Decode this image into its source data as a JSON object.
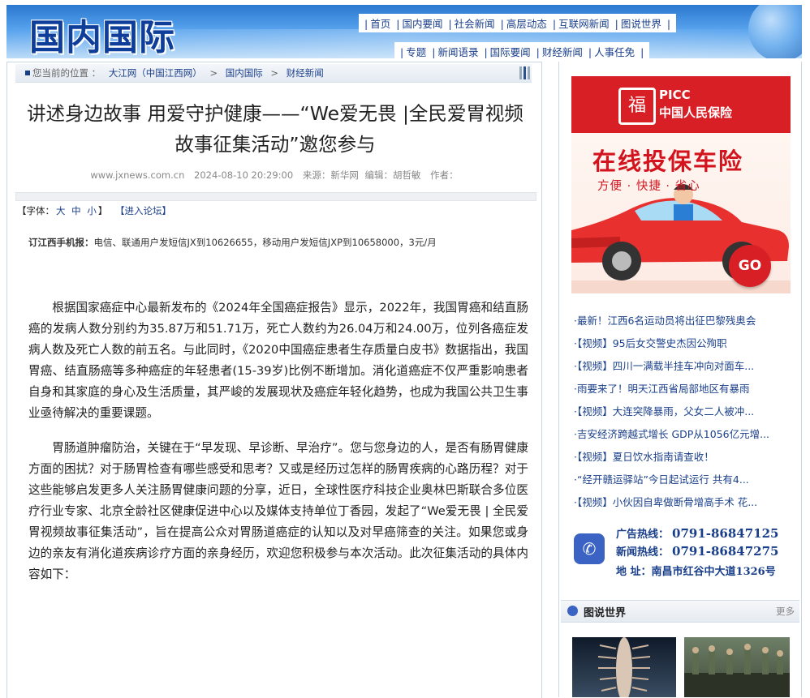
{
  "header": {
    "logo_text": "国内国际",
    "nav_row1": [
      "首页",
      "国内要闻",
      "社会新闻",
      "高层动态",
      "互联网新闻",
      "图说世界"
    ],
    "nav_row2": [
      "专题",
      "新闻语录",
      "国际要闻",
      "财经新闻",
      "人事任免"
    ]
  },
  "breadcrumb": {
    "prefix": "您当前的位置 ：",
    "items": [
      "大江网（中国江西网）",
      "国内国际",
      "财经新闻"
    ],
    "separator": ">"
  },
  "article": {
    "title": "讲述身边故事 用爱守护健康——“We爱无畏 |全民爱胃视频故事征集活动”邀您参与",
    "source_site": "www.jxnews.com.cn",
    "datetime": "2024-08-10 20:29:00",
    "source": "来源：新华网",
    "editor": "编辑：胡哲敏",
    "author": "作者：",
    "font_label": "【字体：",
    "font_sizes": [
      "大",
      "中",
      "小"
    ],
    "font_close": "】",
    "forum_link": "【进入论坛】",
    "subscribe_bold": "订江西手机报：",
    "subscribe_text": "电信、联通用户发短信JX到10626655，移动用户发短信JXP到10658000，3元/月",
    "paragraphs": [
      "根据国家癌症中心最新发布的《2024年全国癌症报告》显示，2022年，我国胃癌和结直肠癌的发病人数分别约为35.87万和51.71万，死亡人数约为26.04万和24.00万，位列各癌症发病人数及死亡人数的前五名。与此同时，《2020中国癌症患者生存质量白皮书》数据指出，我国胃癌、结直肠癌等多种癌症的年轻患者(15-39岁)比例不断增加。消化道癌症不仅严重影响患者自身和其家庭的身心及生活质量，其严峻的发展现状及癌症年轻化趋势，也成为我国公共卫生事业亟待解决的重要课题。",
      "胃肠道肿瘤防治，关键在于“早发现、早诊断、早治疗”。您与您身边的人，是否有肠胃健康方面的困扰？对于肠胃检查有哪些感受和思考？又或是经历过怎样的肠胃疾病的心路历程？对于这些能够启发更多人关注肠胃健康问题的分享，近日，全球性医疗科技企业奥林巴斯联合多位医疗行业专家、北京全龄社区健康促进中心以及媒体支持单位丁香园，发起了“We爱无畏 | 全民爱胃视频故事征集活动”，旨在提高公众对胃肠道癌症的认知以及对早癌筛查的关注。如果您或身边的亲友有消化道疾病诊疗方面的亲身经历，欢迎您积极参与本次活动。此次征集活动的具体内容如下："
    ]
  },
  "ad_picc": {
    "brand": "PICC",
    "brand_cn": "中国人民保险",
    "headline": "在线投保车险",
    "slogan": "方便 · 快捷 · 省心",
    "button": "GO",
    "colors": {
      "red": "#d81f26"
    }
  },
  "side_news": [
    "·最新！江西6名运动员将出征巴黎残奥会",
    "·【视频】95后女交警史杰因公殉职",
    "·【视频】四川一满载半挂车冲向对面车...",
    "·雨要来了！明天江西省局部地区有暴雨",
    "·【视频】大连突降暴雨，父女二人被冲...",
    "·吉安经济跨越式增长 GDP从1056亿元增...",
    "·【视频】夏日饮水指南请查收！",
    "·“经开赣运驿站”今日起试运行 共有4...",
    "·【视频】小伙因自卑做断骨增高手术 花..."
  ],
  "hotline": {
    "ad_label": "广告热线：",
    "ad_phone": "0791-86847125",
    "news_label": "新闻热线：",
    "news_phone": "0791-86847275",
    "addr_label": "地  址：",
    "addr": "南昌市红谷中大道1326号"
  },
  "gallery": {
    "title": "图说世界",
    "more": "更多"
  }
}
